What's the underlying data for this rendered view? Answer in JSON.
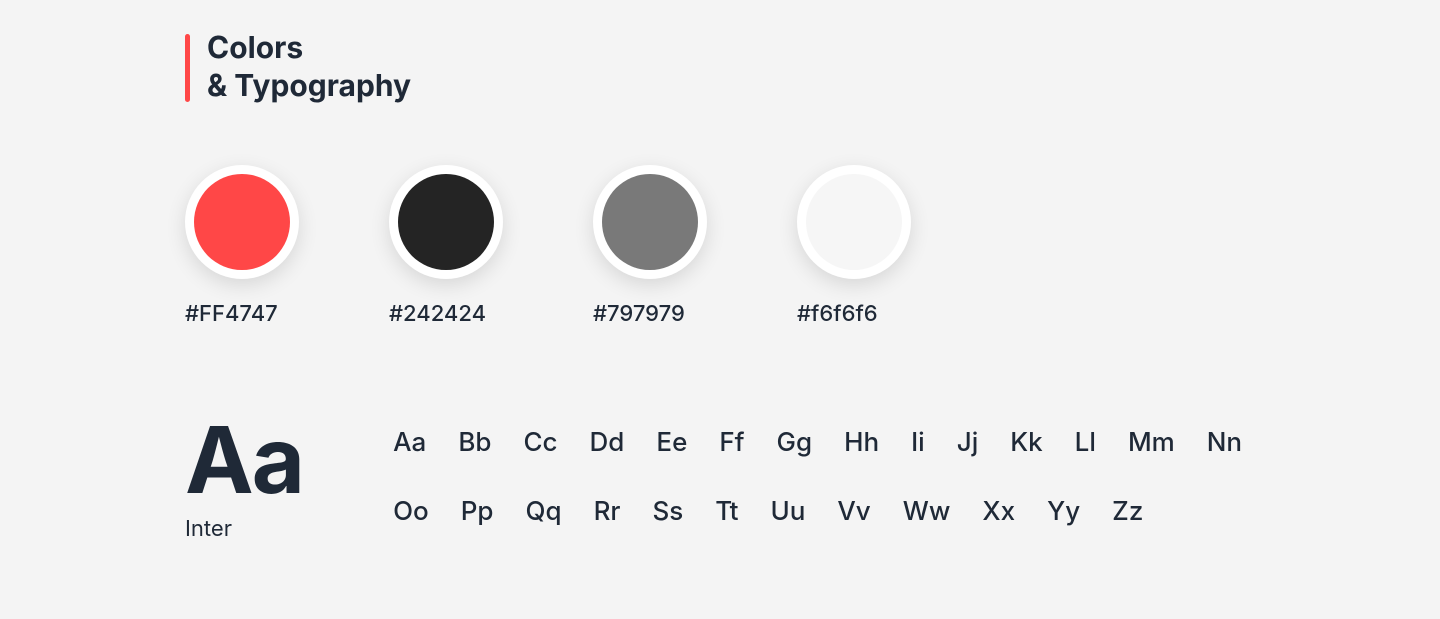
{
  "heading": {
    "line1": "Colors",
    "line2": "& Typography",
    "accent_color": "#FF4747"
  },
  "swatches": [
    {
      "hex": "#FF4747",
      "label": "#FF4747"
    },
    {
      "hex": "#242424",
      "label": "#242424"
    },
    {
      "hex": "#797979",
      "label": "#797979"
    },
    {
      "hex": "#f6f6f6",
      "label": "#f6f6f6"
    }
  ],
  "typography": {
    "sample": "Aa",
    "font_name": "Inter",
    "glyphs_row1": [
      "Aa",
      "Bb",
      "Cc",
      "Dd",
      "Ee",
      "Ff",
      "Gg",
      "Hh",
      "Ii",
      "Jj",
      "Kk",
      "Ll",
      "Mm",
      "Nn"
    ],
    "glyphs_row2": [
      "Oo",
      "Pp",
      "Qq",
      "Rr",
      "Ss",
      "Tt",
      "Uu",
      "Vv",
      "Ww",
      "Xx",
      "Yy",
      "Zz"
    ]
  }
}
